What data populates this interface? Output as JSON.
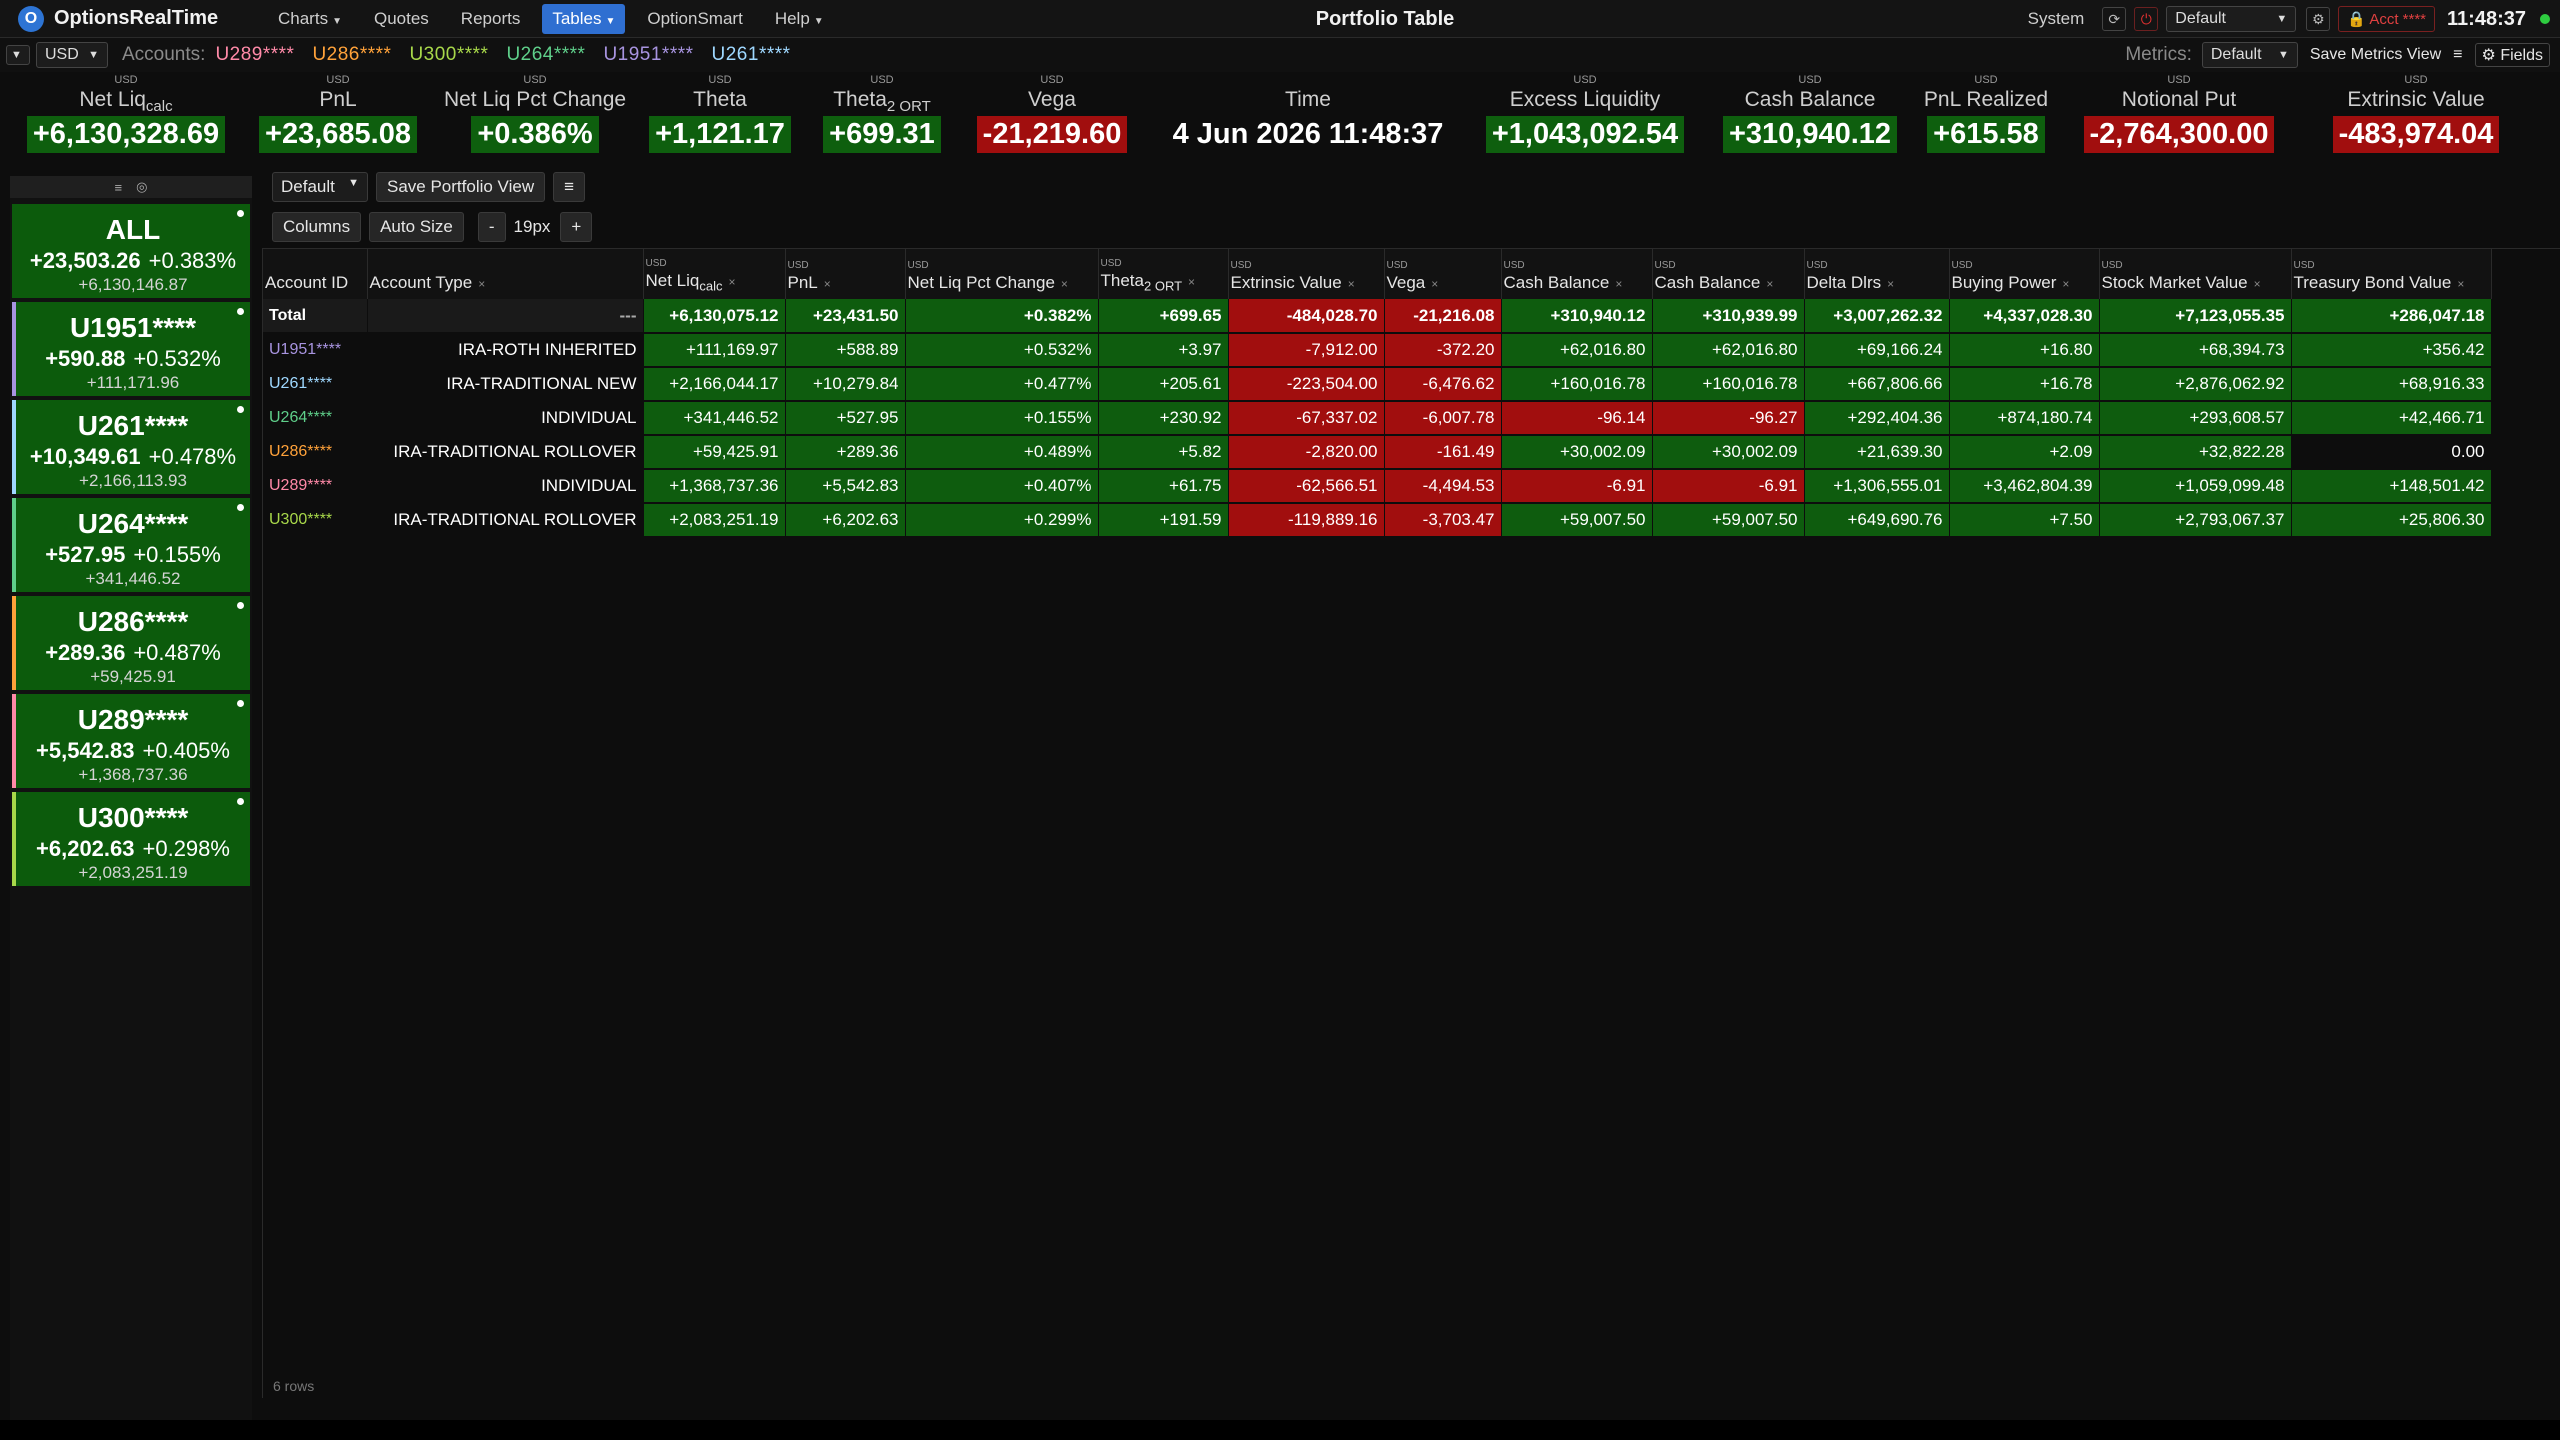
{
  "app": {
    "name": "OptionsRealTime",
    "logo_glyph": "O",
    "page_title": "Portfolio Table"
  },
  "menu": [
    {
      "label": "Charts",
      "caret": "▼"
    },
    {
      "label": "Quotes",
      "caret": ""
    },
    {
      "label": "Reports",
      "caret": ""
    },
    {
      "label": "Tables",
      "caret": "▼",
      "active": true
    },
    {
      "label": "OptionSmart",
      "caret": ""
    },
    {
      "label": "Help",
      "caret": "▼"
    }
  ],
  "system": {
    "label": "System",
    "profile": "Default",
    "acct_badge": "Acct ****",
    "clock": "11:48:37",
    "status_color": "#2ecc40"
  },
  "accounts_bar": {
    "currency": "USD",
    "label": "Accounts:",
    "accounts": [
      {
        "id": "U289****",
        "color": "#ff8aa8"
      },
      {
        "id": "U286****",
        "color": "#ffa23a"
      },
      {
        "id": "U300****",
        "color": "#a8d84a"
      },
      {
        "id": "U264****",
        "color": "#5fcf8a"
      },
      {
        "id": "U1951****",
        "color": "#a894e0"
      },
      {
        "id": "U261****",
        "color": "#9fd8ff"
      }
    ],
    "metrics_label": "Metrics:",
    "metrics_profile": "Default",
    "save_metrics": "Save Metrics View",
    "fields": "Fields"
  },
  "metrics": [
    {
      "usd": "USD",
      "label": "Net Liq",
      "sub": "calc",
      "value": "+6,130,328.69",
      "sign": "pos"
    },
    {
      "usd": "USD",
      "label": "PnL",
      "sub": "",
      "value": "+23,685.08",
      "sign": "pos"
    },
    {
      "usd": "USD",
      "label": "Net Liq Pct Change",
      "sub": "",
      "value": "+0.386%",
      "sign": "pos"
    },
    {
      "usd": "USD",
      "label": "Theta",
      "sub": "",
      "value": "+1,121.17",
      "sign": "pos"
    },
    {
      "usd": "USD",
      "label": "Theta",
      "sub": "2 ORT",
      "value": "+699.31",
      "sign": "pos"
    },
    {
      "usd": "USD",
      "label": "Vega",
      "sub": "",
      "value": "-21,219.60",
      "sign": "neg"
    },
    {
      "usd": "",
      "label": "Time",
      "sub": "",
      "value": "4 Jun 2026 11:48:37",
      "sign": "plain"
    },
    {
      "usd": "USD",
      "label": "Excess Liquidity",
      "sub": "",
      "value": "+1,043,092.54",
      "sign": "pos"
    },
    {
      "usd": "USD",
      "label": "Cash Balance",
      "sub": "",
      "value": "+310,940.12",
      "sign": "pos"
    },
    {
      "usd": "USD",
      "label": "PnL Realized",
      "sub": "",
      "value": "+615.58",
      "sign": "pos"
    },
    {
      "usd": "USD",
      "label": "Notional Put",
      "sub": "",
      "value": "-2,764,300.00",
      "sign": "neg"
    },
    {
      "usd": "USD",
      "label": "Extrinsic Value",
      "sub": "",
      "value": "-483,974.04",
      "sign": "neg"
    }
  ],
  "sidebar": {
    "tools": [
      "≡",
      "◎"
    ],
    "cards": [
      {
        "name": "ALL",
        "pnl": "+23,503.26",
        "pct": "+0.383%",
        "liq": "+6,130,146.87",
        "bar": "#0c5b0c"
      },
      {
        "name": "U1951****",
        "pnl": "+590.88",
        "pct": "+0.532%",
        "liq": "+111,171.96",
        "bar": "#a894e0"
      },
      {
        "name": "U261****",
        "pnl": "+10,349.61",
        "pct": "+0.478%",
        "liq": "+2,166,113.93",
        "bar": "#9fd8ff"
      },
      {
        "name": "U264****",
        "pnl": "+527.95",
        "pct": "+0.155%",
        "liq": "+341,446.52",
        "bar": "#5fcf8a"
      },
      {
        "name": "U286****",
        "pnl": "+289.36",
        "pct": "+0.487%",
        "liq": "+59,425.91",
        "bar": "#ffa23a"
      },
      {
        "name": "U289****",
        "pnl": "+5,542.83",
        "pct": "+0.405%",
        "liq": "+1,368,737.36",
        "bar": "#ff8aa8"
      },
      {
        "name": "U300****",
        "pnl": "+6,202.63",
        "pct": "+0.298%",
        "liq": "+2,083,251.19",
        "bar": "#a8d84a"
      }
    ]
  },
  "toolbar": {
    "view_select": "Default",
    "save_view": "Save Portfolio View",
    "menu_glyph": "≡",
    "columns": "Columns",
    "auto_size": "Auto Size",
    "minus": "-",
    "size": "19px",
    "plus": "+"
  },
  "table": {
    "columns": [
      {
        "label": "Account ID",
        "sub": "",
        "usd": "",
        "x": ""
      },
      {
        "label": "Account Type",
        "sub": "",
        "usd": "",
        "x": "×"
      },
      {
        "label": "Net Liq",
        "sub": "calc",
        "usd": "USD",
        "x": "×"
      },
      {
        "label": "PnL",
        "sub": "",
        "usd": "USD",
        "x": "×"
      },
      {
        "label": "Net Liq Pct Change",
        "sub": "",
        "usd": "USD",
        "x": "×"
      },
      {
        "label": "Theta",
        "sub": "2 ORT",
        "usd": "USD",
        "x": "×"
      },
      {
        "label": "Extrinsic Value",
        "sub": "",
        "usd": "USD",
        "x": "×"
      },
      {
        "label": "Vega",
        "sub": "",
        "usd": "USD",
        "x": "×"
      },
      {
        "label": "Cash Balance",
        "sub": "",
        "usd": "USD",
        "x": "×"
      },
      {
        "label": "Cash Balance",
        "sub": "",
        "usd": "USD",
        "x": "×"
      },
      {
        "label": "Delta Dlrs",
        "sub": "",
        "usd": "USD",
        "x": "×"
      },
      {
        "label": "Buying Power",
        "sub": "",
        "usd": "USD",
        "x": "×"
      },
      {
        "label": "Stock Market Value",
        "sub": "",
        "usd": "USD",
        "x": "×"
      },
      {
        "label": "Treasury Bond Value",
        "sub": "",
        "usd": "USD",
        "x": "×"
      }
    ],
    "rows": [
      {
        "id": "Total",
        "id_color": "#ffffff",
        "type": "---",
        "total": true,
        "cells": [
          "+6,130,075.12",
          "+23,431.50",
          "+0.382%",
          "+699.65",
          "-484,028.70",
          "-21,216.08",
          "+310,940.12",
          "+310,939.99",
          "+3,007,262.32",
          "+4,337,028.30",
          "+7,123,055.35",
          "+286,047.18"
        ]
      },
      {
        "id": "U1951****",
        "id_color": "#a894e0",
        "type": "IRA-ROTH INHERITED",
        "cells": [
          "+111,169.97",
          "+588.89",
          "+0.532%",
          "+3.97",
          "-7,912.00",
          "-372.20",
          "+62,016.80",
          "+62,016.80",
          "+69,166.24",
          "+16.80",
          "+68,394.73",
          "+356.42"
        ]
      },
      {
        "id": "U261****",
        "id_color": "#9fd8ff",
        "type": "IRA-TRADITIONAL NEW",
        "cells": [
          "+2,166,044.17",
          "+10,279.84",
          "+0.477%",
          "+205.61",
          "-223,504.00",
          "-6,476.62",
          "+160,016.78",
          "+160,016.78",
          "+667,806.66",
          "+16.78",
          "+2,876,062.92",
          "+68,916.33"
        ]
      },
      {
        "id": "U264****",
        "id_color": "#5fcf8a",
        "type": "INDIVIDUAL",
        "cells": [
          "+341,446.52",
          "+527.95",
          "+0.155%",
          "+230.92",
          "-67,337.02",
          "-6,007.78",
          "-96.14",
          "-96.27",
          "+292,404.36",
          "+874,180.74",
          "+293,608.57",
          "+42,466.71"
        ]
      },
      {
        "id": "U286****",
        "id_color": "#ffa23a",
        "type": "IRA-TRADITIONAL ROLLOVER",
        "cells": [
          "+59,425.91",
          "+289.36",
          "+0.489%",
          "+5.82",
          "-2,820.00",
          "-161.49",
          "+30,002.09",
          "+30,002.09",
          "+21,639.30",
          "+2.09",
          "+32,822.28",
          "0.00"
        ]
      },
      {
        "id": "U289****",
        "id_color": "#ff8aa8",
        "type": "INDIVIDUAL",
        "cells": [
          "+1,368,737.36",
          "+5,542.83",
          "+0.407%",
          "+61.75",
          "-62,566.51",
          "-4,494.53",
          "-6.91",
          "-6.91",
          "+1,306,555.01",
          "+3,462,804.39",
          "+1,059,099.48",
          "+148,501.42"
        ]
      },
      {
        "id": "U300****",
        "id_color": "#a8d84a",
        "type": "IRA-TRADITIONAL ROLLOVER",
        "cells": [
          "+2,083,251.19",
          "+6,202.63",
          "+0.299%",
          "+191.59",
          "-119,889.16",
          "-3,703.47",
          "+59,007.50",
          "+59,007.50",
          "+649,690.76",
          "+7.50",
          "+2,793,067.37",
          "+25,806.30"
        ]
      }
    ],
    "row_count": "6 rows"
  }
}
